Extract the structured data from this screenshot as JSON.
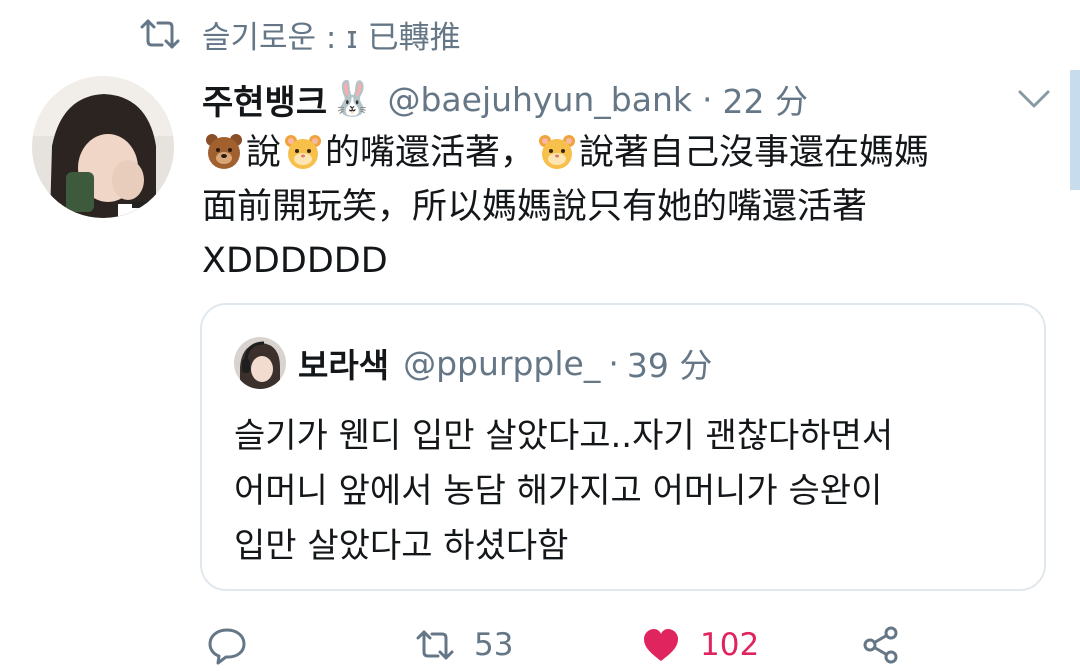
{
  "colors": {
    "secondary_text": "#657786",
    "primary_text": "#14171a",
    "like_red": "#e0245e",
    "border": "#e1e8ed"
  },
  "retweet_context": {
    "icon": "retweet-icon",
    "text": "슬기로운 : ɪ 已轉推"
  },
  "tweet": {
    "display_name": "주현뱅크",
    "name_emoji": "🐰",
    "handle": "@baejuhyun_bank",
    "separator": "·",
    "time": "22 分",
    "text": {
      "line1": {
        "emoji_a": "bear-face-emoji",
        "part_a": "說",
        "emoji_b": "hamster-face-emoji",
        "part_b": "的嘴還活著，",
        "emoji_c": "hamster-face-emoji",
        "part_c": "說著自己沒事還在媽媽"
      },
      "line2": "面前開玩笑，所以媽媽說只有她的嘴還活著",
      "line3": "XDDDDDD"
    },
    "menu_icon": "chevron-down-icon"
  },
  "quote": {
    "display_name": "보라색",
    "handle": "@ppurpple_",
    "separator": "·",
    "time": "39 分",
    "text": {
      "line1": "슬기가 웬디 입만 살았다고..자기 괜찮다하면서",
      "line2": "어머니 앞에서 농담 해가지고 어머니가 승완이",
      "line3": "입만 살았다고 하셨다함"
    }
  },
  "actions": {
    "reply": {
      "icon": "reply-icon",
      "count": ""
    },
    "retweet": {
      "icon": "retweet-icon",
      "count": "53"
    },
    "like": {
      "icon": "heart-filled-icon",
      "count": "102",
      "liked": true
    },
    "share": {
      "icon": "share-icon"
    }
  }
}
